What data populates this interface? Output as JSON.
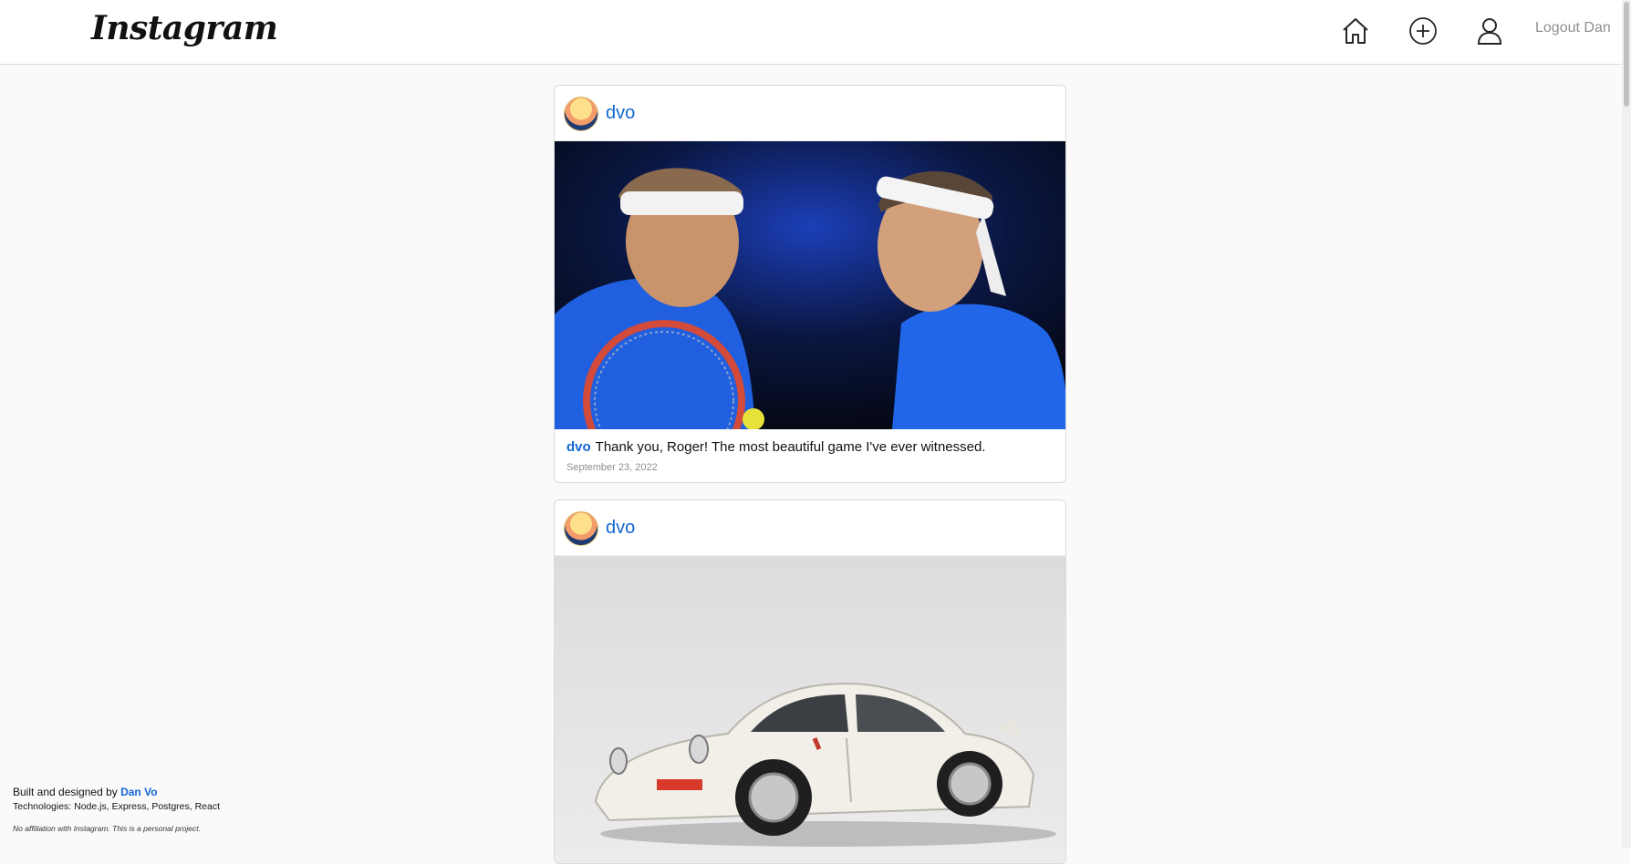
{
  "header": {
    "logo": "Instagram",
    "logout_label": "Logout Dan"
  },
  "posts": [
    {
      "username": "dvo",
      "caption_user": "dvo",
      "caption": "Thank you, Roger! The most beautiful game I've ever witnessed.",
      "date": "September 23, 2022"
    },
    {
      "username": "dvo"
    }
  ],
  "footer": {
    "built_prefix": "Built and designed by",
    "author": "Dan Vo",
    "technologies": "Technologies: Node.js, Express, Postgres, React",
    "disclaimer": "No affiliation with Instagram. This is a personal project."
  },
  "colors": {
    "link": "#1366d6",
    "background": "#fafafa",
    "border": "#dbdbdb"
  },
  "icons": [
    "home-icon",
    "plus-circle-icon",
    "user-icon"
  ]
}
